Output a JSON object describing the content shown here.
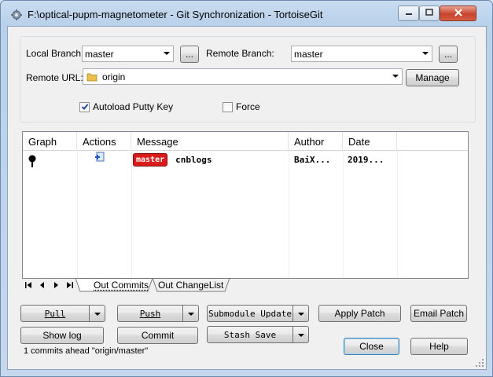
{
  "window": {
    "title": "F:\\optical-pupm-magnetometer - Git Synchronization - TortoiseGit"
  },
  "form": {
    "local_branch_label": "Local Branch:",
    "local_branch_value": "master",
    "local_branch_browse": "...",
    "remote_branch_label": "Remote Branch:",
    "remote_branch_value": "master",
    "remote_branch_browse": "...",
    "remote_url_label": "Remote URL:",
    "remote_url_value": "origin",
    "manage_label": "Manage",
    "autoload_label": "Autoload Putty Key",
    "autoload_checked": true,
    "force_label": "Force",
    "force_checked": false
  },
  "log_list": {
    "columns": [
      "Graph",
      "Actions",
      "Message",
      "Author",
      "Date"
    ],
    "rows": [
      {
        "branch": "master",
        "message": "cnblogs",
        "author": "BaiX...",
        "date": "2019..."
      }
    ]
  },
  "tabs": [
    {
      "label": "Out Commits",
      "active": true
    },
    {
      "label": "Out ChangeList",
      "active": false
    }
  ],
  "buttons": {
    "pull": "Pull",
    "push": "Push",
    "submodule_update": "Submodule Update",
    "apply_patch": "Apply Patch",
    "email_patch": "Email Patch",
    "show_log": "Show log",
    "commit": "Commit",
    "stash_save": "Stash Save",
    "close": "Close",
    "help": "Help"
  },
  "status": {
    "text": "1 commits ahead \"origin/master\""
  },
  "colors": {
    "branch_badge": "#d81b1b",
    "title_bg": "#c9dcf0",
    "close_caption": "#c7432c"
  }
}
